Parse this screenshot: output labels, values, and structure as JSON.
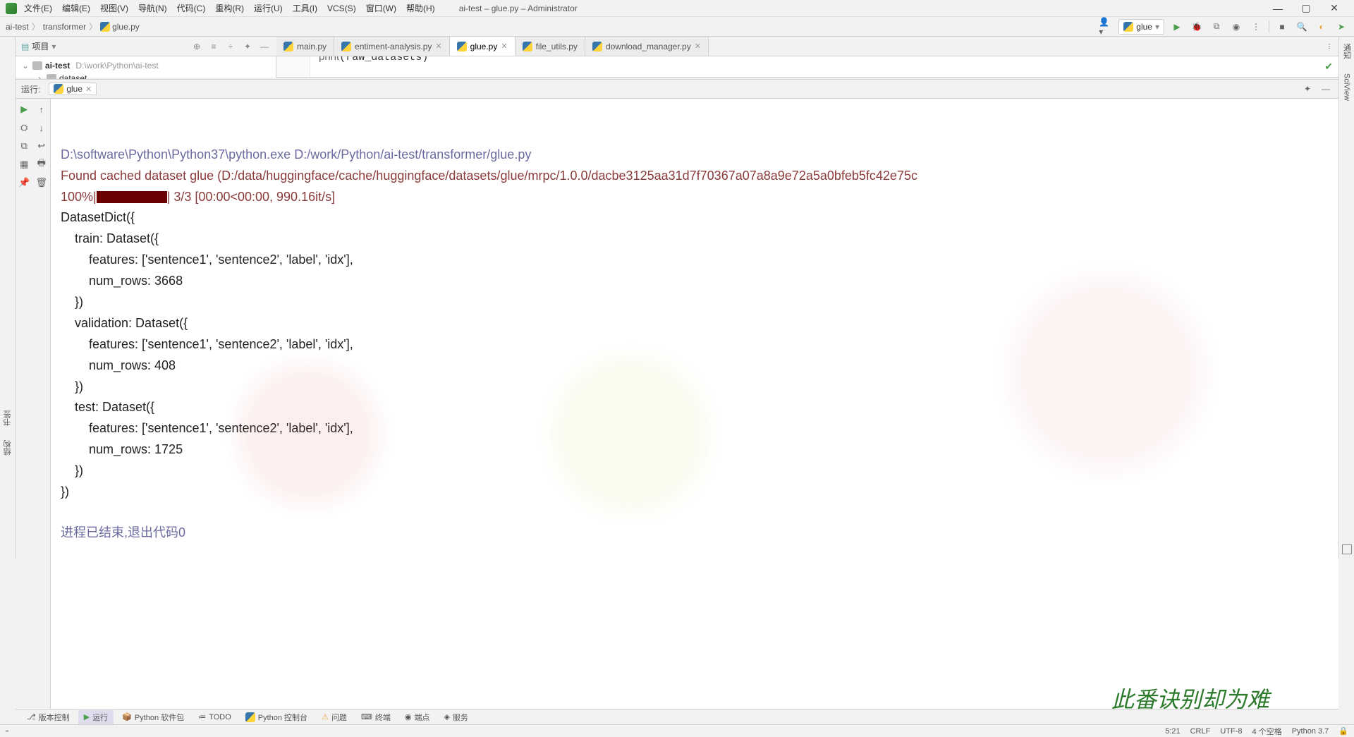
{
  "titlebar": {
    "menus": [
      "文件(E)",
      "编辑(E)",
      "视图(V)",
      "导航(N)",
      "代码(C)",
      "重构(R)",
      "运行(U)",
      "工具(I)",
      "VCS(S)",
      "窗口(W)",
      "帮助(H)"
    ],
    "title": "ai-test – glue.py – Administrator"
  },
  "breadcrumbs": [
    "ai-test",
    "transformer",
    "glue.py"
  ],
  "run_config": {
    "label": "glue"
  },
  "project": {
    "panel_title": "项目",
    "root": {
      "name": "ai-test",
      "path": "D:\\work\\Python\\ai-test"
    },
    "child": "dataset"
  },
  "tabs": [
    {
      "name": "main.py",
      "active": false
    },
    {
      "name": "entiment-analysis.py",
      "active": false
    },
    {
      "name": "glue.py",
      "active": true
    },
    {
      "name": "file_utils.py",
      "active": false
    },
    {
      "name": "download_manager.py",
      "active": false
    }
  ],
  "editor_peek": "print(raw_datasets)",
  "run_panel": {
    "title": "运行:",
    "tab": "glue"
  },
  "console": {
    "cmd": "D:\\software\\Python\\Python37\\python.exe D:/work/Python/ai-test/transformer/glue.py",
    "cache_line": "Found cached dataset glue (D:/data/huggingface/cache/huggingface/datasets/glue/mrpc/1.0.0/dacbe3125aa31d7f70367a07a8a9e72a5a0bfeb5fc42e75c",
    "progress_prefix": "100%|",
    "progress_suffix": "| 3/3 [00:00<00:00, 990.16it/s]",
    "output_lines": [
      "DatasetDict({",
      "    train: Dataset({",
      "        features: ['sentence1', 'sentence2', 'label', 'idx'],",
      "        num_rows: 3668",
      "    })",
      "    validation: Dataset({",
      "        features: ['sentence1', 'sentence2', 'label', 'idx'],",
      "        num_rows: 408",
      "    })",
      "    test: Dataset({",
      "        features: ['sentence1', 'sentence2', 'label', 'idx'],",
      "        num_rows: 1725",
      "    })",
      "})"
    ],
    "exit_msg": "进程已结束,退出代码0"
  },
  "left_gutter_tabs": [
    "书签",
    "结构"
  ],
  "right_gutter_tabs": [
    "通知",
    "SciView"
  ],
  "bottom_tools": [
    {
      "label": "版本控制",
      "icon": "branch"
    },
    {
      "label": "运行",
      "icon": "play",
      "active": true
    },
    {
      "label": "Python 软件包",
      "icon": "pkg"
    },
    {
      "label": "TODO",
      "icon": "todo"
    },
    {
      "label": "Python 控制台",
      "icon": "pycon"
    },
    {
      "label": "问题",
      "icon": "warn"
    },
    {
      "label": "终端",
      "icon": "term"
    },
    {
      "label": "端点",
      "icon": "endpoint"
    },
    {
      "label": "服务",
      "icon": "services"
    }
  ],
  "statusbar": {
    "pos": "5:21",
    "eol": "CRLF",
    "encoding": "UTF-8",
    "indent": "4 个空格",
    "interpreter": "Python 3.7"
  },
  "watermark": "此番诀别却为难"
}
